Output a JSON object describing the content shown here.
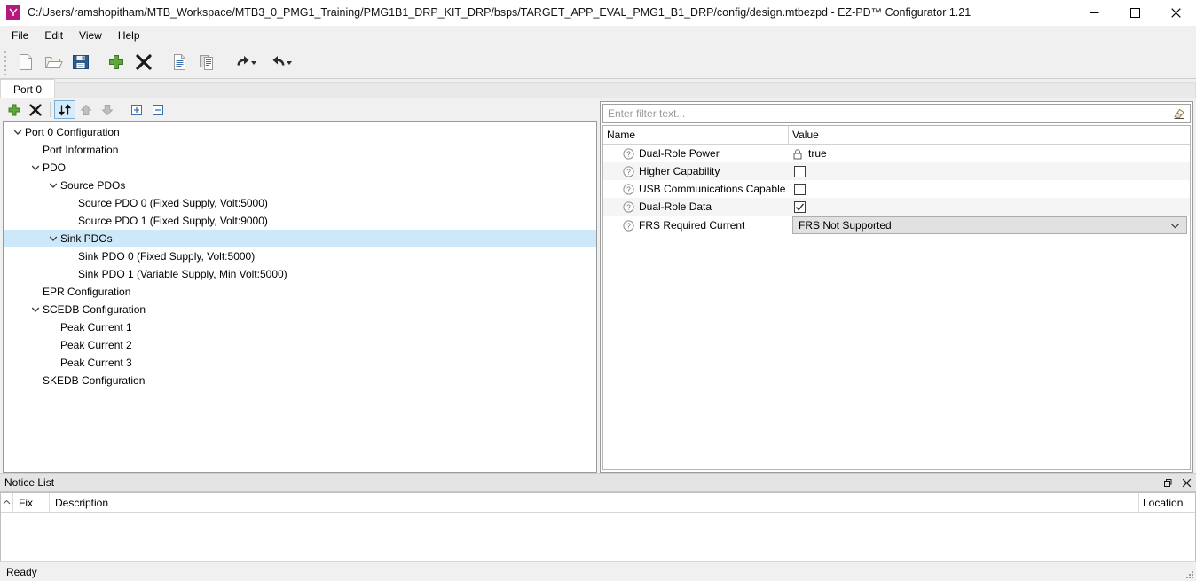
{
  "window": {
    "title": "C:/Users/ramshopitham/MTB_Workspace/MTB3_0_PMG1_Training/PMG1B1_DRP_KIT_DRP/bsps/TARGET_APP_EVAL_PMG1_B1_DRP/config/design.mtbezpd - EZ-PD™ Configurator 1.21",
    "app_icon": "ezpd-app-icon",
    "controls": {
      "minimize": "minimize-button",
      "maximize": "maximize-button",
      "close": "close-button"
    }
  },
  "menubar": {
    "items": [
      {
        "label": "File"
      },
      {
        "label": "Edit"
      },
      {
        "label": "View"
      },
      {
        "label": "Help"
      }
    ]
  },
  "toolbar": {
    "buttons": [
      {
        "name": "new-file-icon",
        "tip": "New"
      },
      {
        "name": "open-folder-icon",
        "tip": "Open"
      },
      {
        "name": "save-icon",
        "tip": "Save"
      },
      {
        "name": "add-icon",
        "tip": "Add"
      },
      {
        "name": "delete-icon",
        "tip": "Delete"
      },
      {
        "name": "copy-icon",
        "tip": "Copy"
      },
      {
        "name": "paste-icon",
        "tip": "Paste"
      },
      {
        "name": "undo-icon",
        "tip": "Undo"
      },
      {
        "name": "redo-icon",
        "tip": "Redo"
      }
    ]
  },
  "tabs": {
    "items": [
      {
        "label": "Port 0",
        "active": true
      }
    ]
  },
  "tree_toolbar": {
    "buttons": [
      {
        "name": "tree-add-icon",
        "state": "enabled"
      },
      {
        "name": "tree-delete-icon",
        "state": "enabled"
      },
      {
        "name": "tree-sort-icon",
        "state": "active"
      },
      {
        "name": "tree-move-up-icon",
        "state": "disabled"
      },
      {
        "name": "tree-move-down-icon",
        "state": "disabled"
      },
      {
        "name": "tree-expand-all-icon",
        "state": "enabled"
      },
      {
        "name": "tree-collapse-all-icon",
        "state": "enabled"
      }
    ]
  },
  "tree": {
    "nodes": [
      {
        "label": "Port 0 Configuration",
        "depth": 0,
        "expander": "expanded",
        "selected": false
      },
      {
        "label": "Port Information",
        "depth": 1,
        "expander": "none",
        "selected": false
      },
      {
        "label": "PDO",
        "depth": 1,
        "expander": "expanded",
        "selected": false
      },
      {
        "label": "Source PDOs",
        "depth": 2,
        "expander": "expanded",
        "selected": false
      },
      {
        "label": "Source PDO 0 (Fixed Supply, Volt:5000)",
        "depth": 3,
        "expander": "none",
        "selected": false
      },
      {
        "label": "Source PDO 1 (Fixed Supply, Volt:9000)",
        "depth": 3,
        "expander": "none",
        "selected": false
      },
      {
        "label": "Sink PDOs",
        "depth": 2,
        "expander": "expanded",
        "selected": true
      },
      {
        "label": "Sink PDO 0 (Fixed Supply, Volt:5000)",
        "depth": 3,
        "expander": "none",
        "selected": false
      },
      {
        "label": "Sink PDO 1 (Variable Supply, Min Volt:5000)",
        "depth": 3,
        "expander": "none",
        "selected": false
      },
      {
        "label": "EPR Configuration",
        "depth": 1,
        "expander": "none",
        "selected": false
      },
      {
        "label": "SCEDB Configuration",
        "depth": 1,
        "expander": "expanded",
        "selected": false
      },
      {
        "label": "Peak Current 1",
        "depth": 2,
        "expander": "none",
        "selected": false
      },
      {
        "label": "Peak Current 2",
        "depth": 2,
        "expander": "none",
        "selected": false
      },
      {
        "label": "Peak Current 3",
        "depth": 2,
        "expander": "none",
        "selected": false
      },
      {
        "label": "SKEDB Configuration",
        "depth": 1,
        "expander": "none",
        "selected": false
      }
    ]
  },
  "properties": {
    "filter": {
      "value": "",
      "placeholder": "Enter filter text...",
      "clear_icon": "eraser-icon"
    },
    "columns": [
      "Name",
      "Value"
    ],
    "rows": [
      {
        "name": "Dual-Role Power",
        "help_icon": "help-icon",
        "value_type": "locked-text",
        "value": "true",
        "lock_icon": "lock-icon"
      },
      {
        "name": "Higher Capability",
        "help_icon": "help-icon",
        "value_type": "checkbox",
        "checked": false
      },
      {
        "name": "USB Communications Capable",
        "help_icon": "help-icon",
        "value_type": "checkbox",
        "checked": false
      },
      {
        "name": "Dual-Role Data",
        "help_icon": "help-icon",
        "value_type": "checkbox",
        "checked": true
      },
      {
        "name": "FRS Required Current",
        "help_icon": "help-icon",
        "value_type": "dropdown",
        "value": "FRS Not Supported"
      }
    ]
  },
  "notice_list": {
    "title": "Notice List",
    "restore_icon": "restore-panel-icon",
    "close_icon": "close-panel-icon",
    "columns": [
      {
        "label": "Fix"
      },
      {
        "label": "Description"
      },
      {
        "label": "Location"
      }
    ],
    "rows": []
  },
  "statusbar": {
    "text": "Ready"
  },
  "colors": {
    "window_bg": "#f0f0f0",
    "selection_blue": "#cde8f8",
    "accent_magenta": "#b5197d",
    "row_alt": "#f5f5f5",
    "combo_bg": "#e1e1e1",
    "save_icon_blue": "#2a6099",
    "add_icon_green": "#5fa83b"
  }
}
